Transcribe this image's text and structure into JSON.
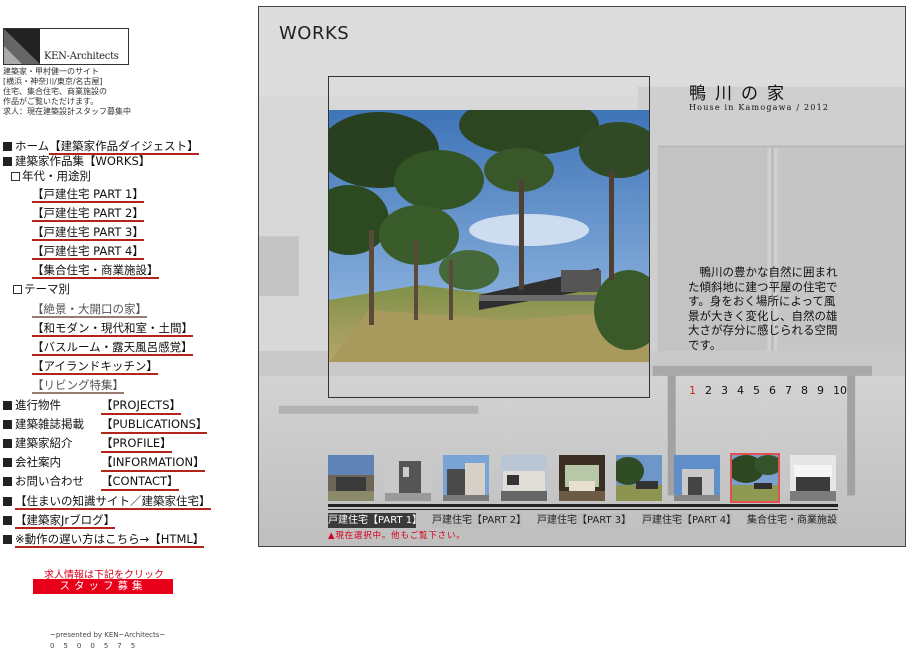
{
  "sidebar": {
    "logo_text": "KEN-Architects",
    "description": "建築家・甲村健一のサイト\n[横浜・神奈川/東京/名古屋]\n住宅、集合住宅、商業施設の\n作品がご覧いただけます。\n求人：現在建築設計スタッフ募集中",
    "nav": {
      "home_label": "ホーム",
      "home_link": "【建築家作品ダイジェスト】",
      "works_label": "建築家作品集【WORKS】",
      "by_year_label": "年代・用途別",
      "year_links": [
        "【戸建住宅 PART 1】",
        "【戸建住宅 PART 2】",
        "【戸建住宅 PART 3】",
        "【戸建住宅 PART 4】",
        "【集合住宅・商業施設】"
      ],
      "by_theme_label": "テーマ別",
      "theme_links": [
        "【絶景・大開口の家】",
        "【和モダン・現代和室・土間】",
        "【バスルーム・露天風呂感覚】",
        "【アイランドキッチン】",
        "【リビング特集】"
      ],
      "info_rows": [
        {
          "label": "進行物件",
          "link": "【PROJECTS】"
        },
        {
          "label": "建築雑誌掲載",
          "link": "【PUBLICATIONS】"
        },
        {
          "label": "建築家紹介",
          "link": "【PROFILE】"
        },
        {
          "label": "会社案内",
          "link": "【INFORMATION】"
        },
        {
          "label": "お問い合わせ",
          "link": "【CONTACT】"
        }
      ],
      "extra_links": [
        "【住まいの知識サイト／建築家住宅】",
        "【建築家Jrブログ】",
        "※動作の遅い方はこちら→【HTML】"
      ]
    },
    "recruit_title": "求人情報は下記をクリック",
    "recruit_button": "スタッフ募集",
    "presented": "~presented by KEN~Architects~",
    "counter": "0500575"
  },
  "works": {
    "title": "WORKS",
    "house_title": "鴨川の家",
    "house_subtitle": "House in Kamogawa / 2012",
    "description": "　鴨川の豊かな自然に囲まれた傾斜地に建つ平屋の住宅です。身をおく場所によって風景が大きく変化し、自然の雄大さが存分に感じられる空間です。",
    "pages": [
      "1",
      "2",
      "3",
      "4",
      "5",
      "6",
      "7",
      "8",
      "9",
      "10"
    ],
    "active_page": "1",
    "thumbnails": 9,
    "selected_thumbnail": 8,
    "tabs": [
      "戸建住宅【PART 1】",
      "戸建住宅【PART 2】",
      "戸建住宅【PART 3】",
      "戸建住宅【PART 4】",
      "集合住宅・商業施設"
    ],
    "active_tab": 0,
    "tab_note": "▲現在選択中。他もご覧下さい。"
  },
  "colors": {
    "accent_red": "#d6001c",
    "link_underline": "#b3251a",
    "panel_bg": "#d6d6d6",
    "active_tab": "#3a3a3a",
    "active_page": "#c8281e"
  },
  "icons": {
    "logo_mark": "logo-triangle-icon",
    "bullet": "black-square-icon",
    "sub_bullet": "outline-square-icon"
  }
}
